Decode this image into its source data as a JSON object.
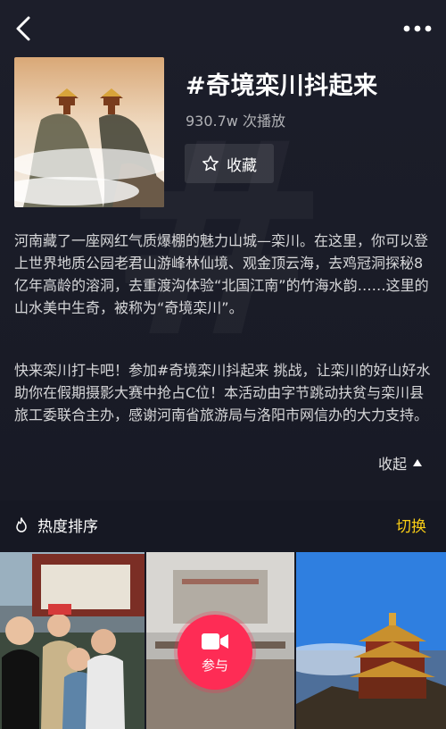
{
  "topbar": {
    "back_icon": "chevron-left-icon",
    "more_icon": "more-dots-icon"
  },
  "challenge": {
    "title": "#奇境栾川抖起来",
    "play_count": "930.7w 次播放",
    "favorite_label": "收藏",
    "favorite_icon": "star-icon",
    "description_p1": "河南藏了一座网红气质爆棚的魅力山城—栾川。在这里，你可以登上世界地质公园老君山游峰林仙境、观金顶云海，去鸡冠洞探秘8亿年高龄的溶洞，去重渡沟体验“北国江南”的竹海水韵……这里的山水美中生奇，被称为“奇境栾川”。",
    "description_p2": "快来栾川打卡吧！参加#奇境栾川抖起来 挑战，让栾川的好山好水助你在假期摄影大赛中抢占C位！本活动由字节跳动扶贫与栾川县旅工委联合主办，感谢河南省旅游局与洛阳市网信办的大力支持。",
    "collapse_label": "收起"
  },
  "sort": {
    "label": "热度排序",
    "icon": "flame-icon",
    "switch_label": "切换"
  },
  "join_button": {
    "label": "参与",
    "icon": "video-camera-icon"
  },
  "colors": {
    "accent": "#fe2c55",
    "switch": "#face15",
    "background": "#161823"
  }
}
